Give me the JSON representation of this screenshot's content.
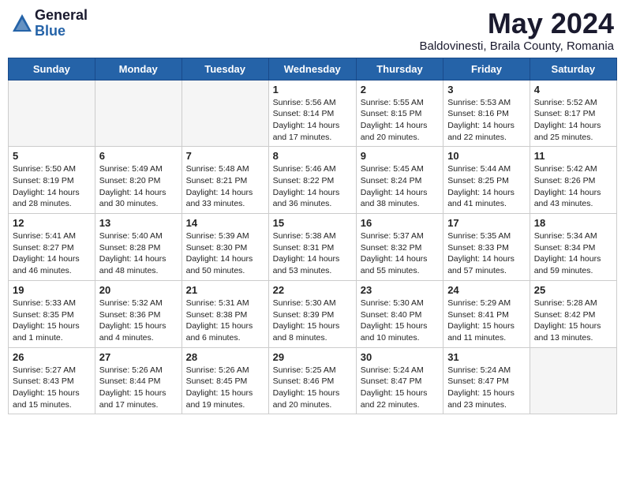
{
  "header": {
    "logo_general": "General",
    "logo_blue": "Blue",
    "month_title": "May 2024",
    "location": "Baldovinesti, Braila County, Romania"
  },
  "days_of_week": [
    "Sunday",
    "Monday",
    "Tuesday",
    "Wednesday",
    "Thursday",
    "Friday",
    "Saturday"
  ],
  "weeks": [
    [
      {
        "day": "",
        "info": ""
      },
      {
        "day": "",
        "info": ""
      },
      {
        "day": "",
        "info": ""
      },
      {
        "day": "1",
        "info": "Sunrise: 5:56 AM\nSunset: 8:14 PM\nDaylight: 14 hours\nand 17 minutes."
      },
      {
        "day": "2",
        "info": "Sunrise: 5:55 AM\nSunset: 8:15 PM\nDaylight: 14 hours\nand 20 minutes."
      },
      {
        "day": "3",
        "info": "Sunrise: 5:53 AM\nSunset: 8:16 PM\nDaylight: 14 hours\nand 22 minutes."
      },
      {
        "day": "4",
        "info": "Sunrise: 5:52 AM\nSunset: 8:17 PM\nDaylight: 14 hours\nand 25 minutes."
      }
    ],
    [
      {
        "day": "5",
        "info": "Sunrise: 5:50 AM\nSunset: 8:19 PM\nDaylight: 14 hours\nand 28 minutes."
      },
      {
        "day": "6",
        "info": "Sunrise: 5:49 AM\nSunset: 8:20 PM\nDaylight: 14 hours\nand 30 minutes."
      },
      {
        "day": "7",
        "info": "Sunrise: 5:48 AM\nSunset: 8:21 PM\nDaylight: 14 hours\nand 33 minutes."
      },
      {
        "day": "8",
        "info": "Sunrise: 5:46 AM\nSunset: 8:22 PM\nDaylight: 14 hours\nand 36 minutes."
      },
      {
        "day": "9",
        "info": "Sunrise: 5:45 AM\nSunset: 8:24 PM\nDaylight: 14 hours\nand 38 minutes."
      },
      {
        "day": "10",
        "info": "Sunrise: 5:44 AM\nSunset: 8:25 PM\nDaylight: 14 hours\nand 41 minutes."
      },
      {
        "day": "11",
        "info": "Sunrise: 5:42 AM\nSunset: 8:26 PM\nDaylight: 14 hours\nand 43 minutes."
      }
    ],
    [
      {
        "day": "12",
        "info": "Sunrise: 5:41 AM\nSunset: 8:27 PM\nDaylight: 14 hours\nand 46 minutes."
      },
      {
        "day": "13",
        "info": "Sunrise: 5:40 AM\nSunset: 8:28 PM\nDaylight: 14 hours\nand 48 minutes."
      },
      {
        "day": "14",
        "info": "Sunrise: 5:39 AM\nSunset: 8:30 PM\nDaylight: 14 hours\nand 50 minutes."
      },
      {
        "day": "15",
        "info": "Sunrise: 5:38 AM\nSunset: 8:31 PM\nDaylight: 14 hours\nand 53 minutes."
      },
      {
        "day": "16",
        "info": "Sunrise: 5:37 AM\nSunset: 8:32 PM\nDaylight: 14 hours\nand 55 minutes."
      },
      {
        "day": "17",
        "info": "Sunrise: 5:35 AM\nSunset: 8:33 PM\nDaylight: 14 hours\nand 57 minutes."
      },
      {
        "day": "18",
        "info": "Sunrise: 5:34 AM\nSunset: 8:34 PM\nDaylight: 14 hours\nand 59 minutes."
      }
    ],
    [
      {
        "day": "19",
        "info": "Sunrise: 5:33 AM\nSunset: 8:35 PM\nDaylight: 15 hours\nand 1 minute."
      },
      {
        "day": "20",
        "info": "Sunrise: 5:32 AM\nSunset: 8:36 PM\nDaylight: 15 hours\nand 4 minutes."
      },
      {
        "day": "21",
        "info": "Sunrise: 5:31 AM\nSunset: 8:38 PM\nDaylight: 15 hours\nand 6 minutes."
      },
      {
        "day": "22",
        "info": "Sunrise: 5:30 AM\nSunset: 8:39 PM\nDaylight: 15 hours\nand 8 minutes."
      },
      {
        "day": "23",
        "info": "Sunrise: 5:30 AM\nSunset: 8:40 PM\nDaylight: 15 hours\nand 10 minutes."
      },
      {
        "day": "24",
        "info": "Sunrise: 5:29 AM\nSunset: 8:41 PM\nDaylight: 15 hours\nand 11 minutes."
      },
      {
        "day": "25",
        "info": "Sunrise: 5:28 AM\nSunset: 8:42 PM\nDaylight: 15 hours\nand 13 minutes."
      }
    ],
    [
      {
        "day": "26",
        "info": "Sunrise: 5:27 AM\nSunset: 8:43 PM\nDaylight: 15 hours\nand 15 minutes."
      },
      {
        "day": "27",
        "info": "Sunrise: 5:26 AM\nSunset: 8:44 PM\nDaylight: 15 hours\nand 17 minutes."
      },
      {
        "day": "28",
        "info": "Sunrise: 5:26 AM\nSunset: 8:45 PM\nDaylight: 15 hours\nand 19 minutes."
      },
      {
        "day": "29",
        "info": "Sunrise: 5:25 AM\nSunset: 8:46 PM\nDaylight: 15 hours\nand 20 minutes."
      },
      {
        "day": "30",
        "info": "Sunrise: 5:24 AM\nSunset: 8:47 PM\nDaylight: 15 hours\nand 22 minutes."
      },
      {
        "day": "31",
        "info": "Sunrise: 5:24 AM\nSunset: 8:47 PM\nDaylight: 15 hours\nand 23 minutes."
      },
      {
        "day": "",
        "info": ""
      }
    ]
  ]
}
